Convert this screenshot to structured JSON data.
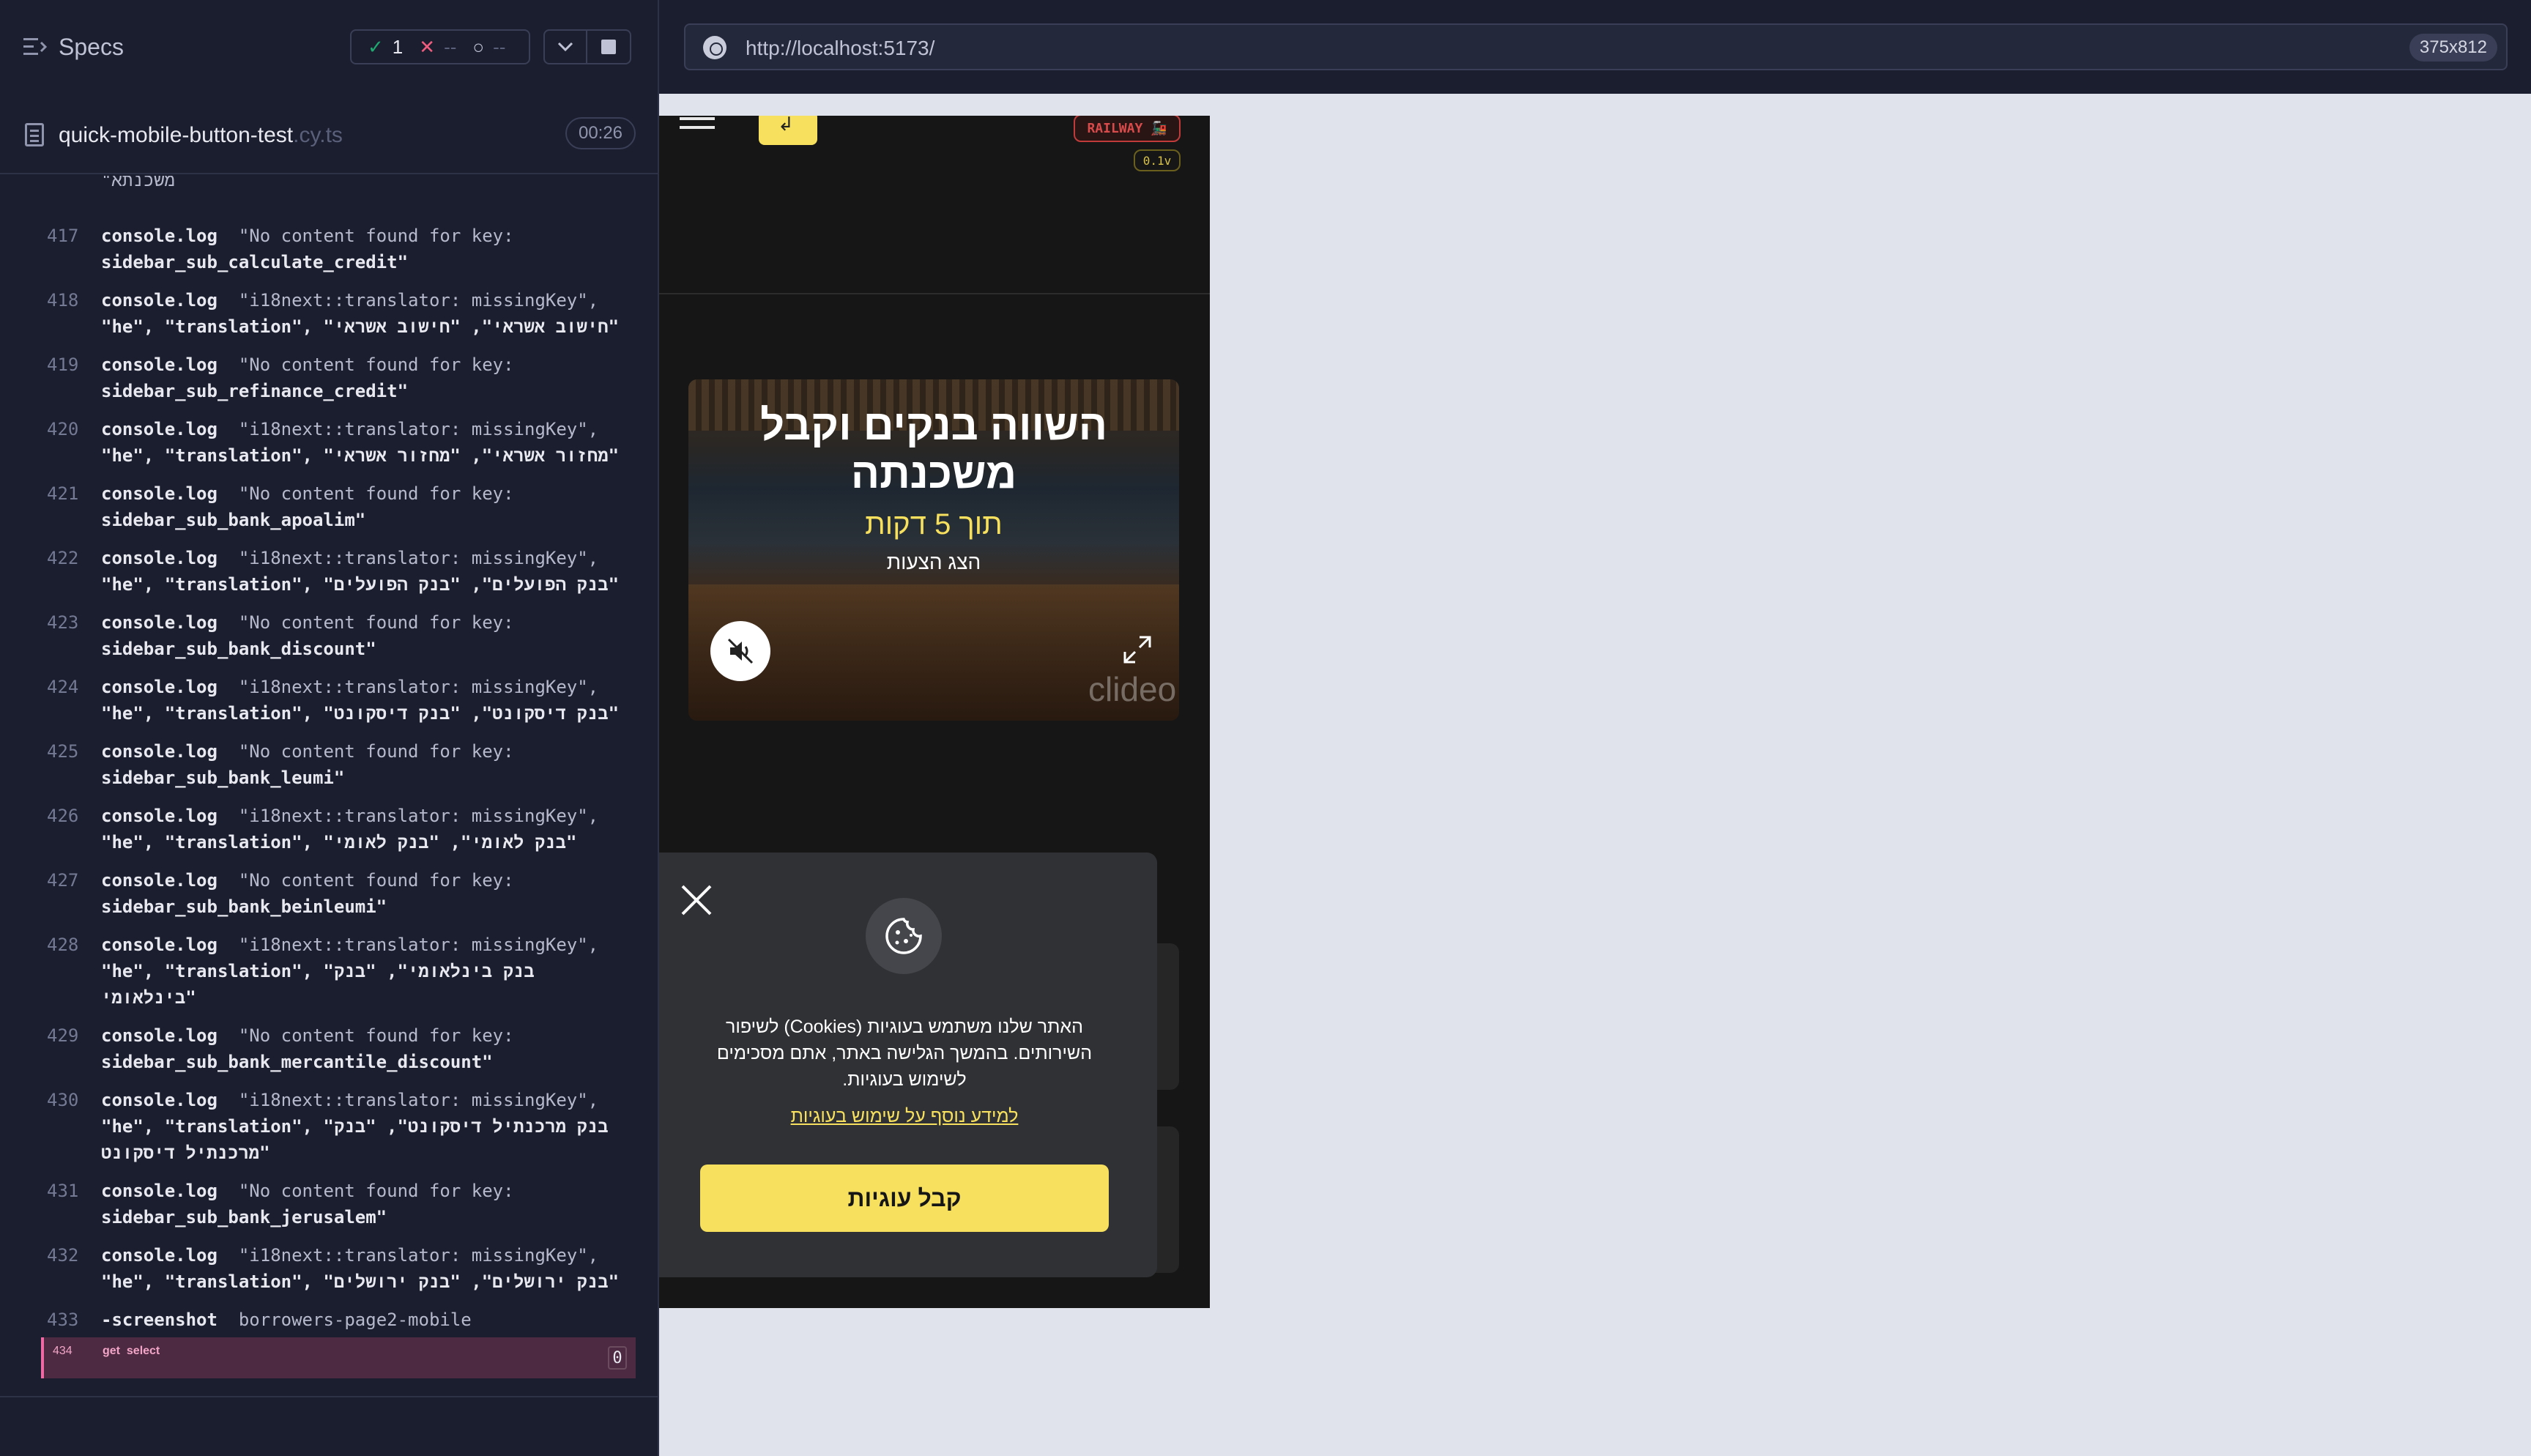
{
  "runner": {
    "specs_label": "Specs",
    "stats": {
      "passed": "1",
      "failed": "--",
      "pending": "--"
    },
    "spec": {
      "name": "quick-mobile-button-test",
      "ext": ".cy.ts",
      "duration": "00:26"
    },
    "log_top_fragment": "\"משכנתא",
    "log": [
      {
        "n": "417",
        "cmd": "console.log",
        "msg": "\"No content found for key:",
        "cont": [
          "sidebar_sub_calculate_credit\""
        ]
      },
      {
        "n": "418",
        "cmd": "console.log",
        "msg": "\"i18next::translator: missingKey\",",
        "cont": [
          "\"he\", \"translation\", \"חישוב אשראי\", \"חישוב אשראי\""
        ]
      },
      {
        "n": "419",
        "cmd": "console.log",
        "msg": "\"No content found for key:",
        "cont": [
          "sidebar_sub_refinance_credit\""
        ]
      },
      {
        "n": "420",
        "cmd": "console.log",
        "msg": "\"i18next::translator: missingKey\",",
        "cont": [
          "\"he\", \"translation\", \"מחזור אשראי\", \"מחזור אשראי\""
        ]
      },
      {
        "n": "421",
        "cmd": "console.log",
        "msg": "\"No content found for key:",
        "cont": [
          "sidebar_sub_bank_apoalim\""
        ]
      },
      {
        "n": "422",
        "cmd": "console.log",
        "msg": "\"i18next::translator: missingKey\",",
        "cont": [
          "\"he\", \"translation\", \"בנק הפועלים\", \"בנק הפועלים\""
        ]
      },
      {
        "n": "423",
        "cmd": "console.log",
        "msg": "\"No content found for key:",
        "cont": [
          "sidebar_sub_bank_discount\""
        ]
      },
      {
        "n": "424",
        "cmd": "console.log",
        "msg": "\"i18next::translator: missingKey\",",
        "cont": [
          "\"he\", \"translation\", \"בנק דיסקונט\", \"בנק דיסקונט\""
        ]
      },
      {
        "n": "425",
        "cmd": "console.log",
        "msg": "\"No content found for key:",
        "cont": [
          "sidebar_sub_bank_leumi\""
        ]
      },
      {
        "n": "426",
        "cmd": "console.log",
        "msg": "\"i18next::translator: missingKey\",",
        "cont": [
          "\"he\", \"translation\", \"בנק לאומי\", \"בנק לאומי\""
        ]
      },
      {
        "n": "427",
        "cmd": "console.log",
        "msg": "\"No content found for key:",
        "cont": [
          "sidebar_sub_bank_beinleumi\""
        ]
      },
      {
        "n": "428",
        "cmd": "console.log",
        "msg": "\"i18next::translator: missingKey\",",
        "cont": [
          "\"he\", \"translation\", \"בנק בינלאומי\", \"בנק",
          "בינלאומי\""
        ]
      },
      {
        "n": "429",
        "cmd": "console.log",
        "msg": "\"No content found for key:",
        "cont": [
          "sidebar_sub_bank_mercantile_discount\""
        ]
      },
      {
        "n": "430",
        "cmd": "console.log",
        "msg": "\"i18next::translator: missingKey\",",
        "cont": [
          "\"he\", \"translation\", \"בנק מרכנתיל דיסקונט\", \"בנק",
          "מרכנתיל דיסקונט\""
        ]
      },
      {
        "n": "431",
        "cmd": "console.log",
        "msg": "\"No content found for key:",
        "cont": [
          "sidebar_sub_bank_jerusalem\""
        ]
      },
      {
        "n": "432",
        "cmd": "console.log",
        "msg": "\"i18next::translator: missingKey\",",
        "cont": [
          "\"he\", \"translation\", \"בנק ירושלים\", \"בנק ירושלים\""
        ]
      },
      {
        "n": "433",
        "cmd": "-screenshot",
        "msg": "borrowers-page2-mobile",
        "cont": []
      }
    ],
    "active": {
      "n": "434",
      "cmd": "get",
      "msg": "select",
      "badge": "0"
    }
  },
  "browser": {
    "url": "http://localhost:5173/",
    "viewport": "375x812"
  },
  "app": {
    "env_badge": "RAILWAY 🚂",
    "version": "0.1v",
    "hero": {
      "title": "השווה בנקים וקבל משכנתה",
      "subtitle": "תוך 5 דקות",
      "small": "הצג הצעות",
      "watermark": "clideo"
    },
    "cookie": {
      "text": "האתר שלנו משתמש בעוגיות (Cookies) לשיפור השירותים. בהמשך הגלישה באתר, אתם מסכימים לשימוש בעוגיות.",
      "link": "למידע נוסף על שימוש בעוגיות",
      "accept": "קבל עוגיות"
    }
  },
  "colors": {
    "accent": "#f6e05e",
    "pass": "#1fa971",
    "fail": "#f05d7f",
    "active": "#ef6aa4"
  },
  "icons": [
    "specs-icon",
    "check-icon",
    "x-icon",
    "pending-icon",
    "chevron-down-icon",
    "stop-icon",
    "file-icon",
    "globe-icon",
    "hamburger-icon",
    "login-icon",
    "mute-icon",
    "expand-icon",
    "close-icon",
    "cookie-icon"
  ]
}
